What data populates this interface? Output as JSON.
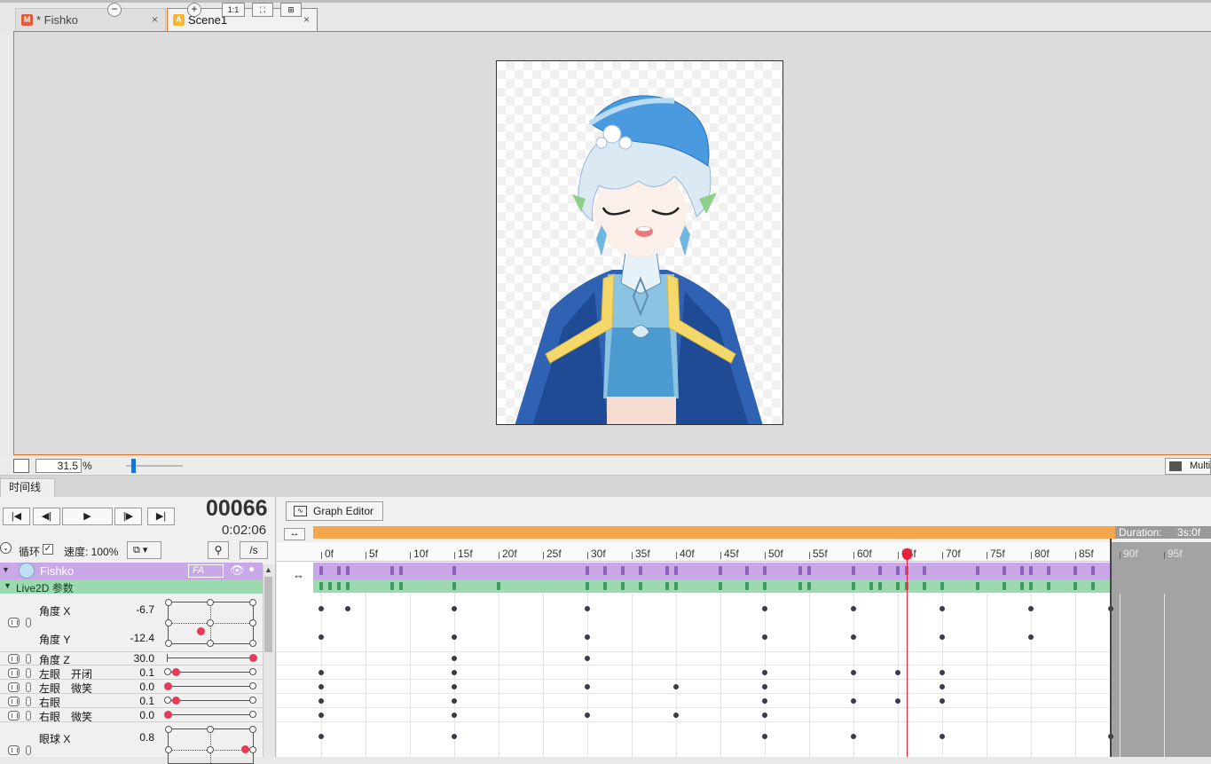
{
  "tabs": [
    {
      "label": "* Fishko",
      "icon": "model-file-icon",
      "close": "×"
    },
    {
      "label": "Scene1",
      "icon": "animation-file-icon",
      "close": "×"
    }
  ],
  "tab_icons": [
    "M",
    "A"
  ],
  "colors": {
    "accent": "#e2701e",
    "keyframe_bar_purple": "#8a63b8",
    "keyframe_bar_green": "#3c9a5e",
    "playhead": "#e8213b",
    "slider_dot": "#e83a55",
    "param_group_purple": "#c8a8e6",
    "live2d_group_green": "#9cd8b0"
  },
  "zoom": {
    "value": "31.5",
    "unit": "%",
    "one_to_one": "1:1"
  },
  "multi_view_label": "Multi",
  "timeline": {
    "panel_tab": "时间线",
    "frame": "00066",
    "time": "0:02:06",
    "loop_label": "循环",
    "speed_label": "速度: 100%",
    "per_second_label": "/s",
    "graph_editor_label": "Graph Editor",
    "duration_label": "Duration:",
    "duration_value": "3s:0f",
    "track_name": "Fishko",
    "track_badge": "FA",
    "group_label": "Live2D 参数",
    "current_frame": 66,
    "ruler": [
      "0f",
      "5f",
      "10f",
      "15f",
      "20f",
      "25f",
      "30f",
      "35f",
      "40f",
      "45f",
      "50f",
      "55f",
      "60f",
      "65f",
      "70f",
      "75f",
      "80f",
      "85f",
      "90f",
      "95f"
    ]
  },
  "params": [
    {
      "name": "角度 X",
      "value": "-6.7"
    },
    {
      "name": "角度 Y",
      "value": "-12.4"
    },
    {
      "name": "角度 Z",
      "value": "30.0"
    },
    {
      "name": "左眼　开闭",
      "value": "0.1"
    },
    {
      "name": "左眼　微笑",
      "value": "0.0"
    },
    {
      "name": "右眼",
      "value": "0.1"
    },
    {
      "name": "右眼　微笑",
      "value": "0.0"
    },
    {
      "name": "眼球 X",
      "value": "0.8"
    }
  ],
  "keyframe_frames": {
    "track_bars": [
      0,
      2,
      3,
      8,
      9,
      15,
      30,
      32,
      34,
      36,
      39,
      40,
      45,
      48,
      50,
      54,
      55,
      60,
      63,
      65,
      66,
      68,
      74,
      77,
      79,
      80,
      82,
      85,
      87
    ],
    "group_bars": [
      0,
      1,
      2,
      3,
      8,
      9,
      15,
      20,
      30,
      32,
      34,
      36,
      39,
      40,
      45,
      48,
      50,
      54,
      55,
      60,
      62,
      63,
      65,
      66,
      68,
      70,
      74,
      77,
      79,
      80,
      82,
      85,
      87
    ],
    "angle_x": [
      0,
      3,
      15,
      30,
      50,
      60,
      70,
      80,
      89
    ],
    "angle_y": [
      0,
      15,
      30,
      50,
      60,
      70,
      80
    ],
    "angle_z": [
      15,
      30
    ],
    "left_eye_open": [
      0,
      15,
      50,
      60,
      65,
      70
    ],
    "left_eye_smile": [
      0,
      15,
      30,
      40,
      50,
      70
    ],
    "right_eye": [
      0,
      15,
      50,
      60,
      65,
      70
    ],
    "right_eye_smile": [
      0,
      15,
      30,
      40,
      50
    ],
    "eyeball_x": [
      0,
      15,
      50,
      60,
      70,
      89
    ]
  }
}
